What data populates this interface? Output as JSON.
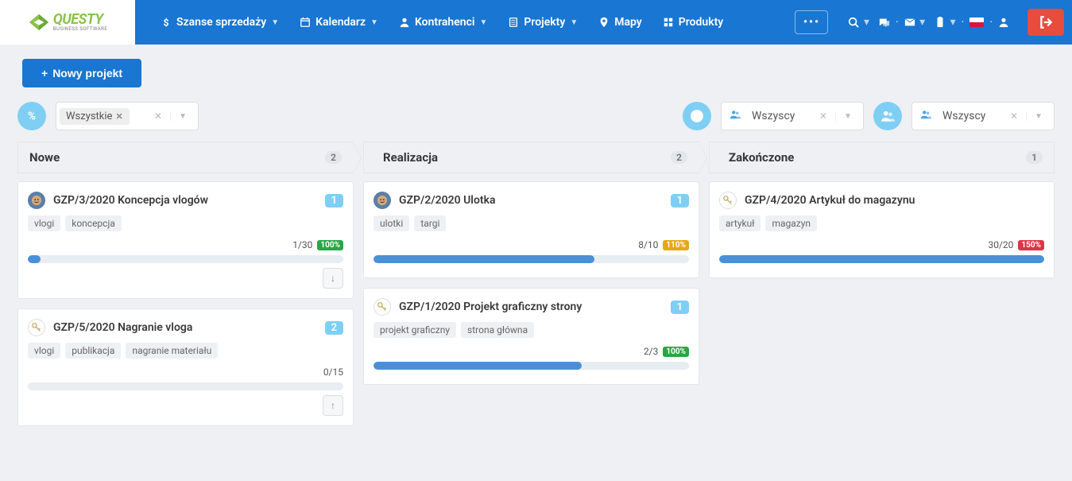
{
  "logo": {
    "brand": "QUESTY",
    "sub": "BUSINESS SOFTWARE"
  },
  "nav": {
    "items": [
      {
        "label": "Szanse sprzedaży",
        "icon": "dollar",
        "caret": true
      },
      {
        "label": "Kalendarz",
        "icon": "calendar",
        "caret": true
      },
      {
        "label": "Kontrahenci",
        "icon": "user",
        "caret": true
      },
      {
        "label": "Projekty",
        "icon": "clipboard",
        "caret": true
      },
      {
        "label": "Mapy",
        "icon": "pin",
        "caret": false
      },
      {
        "label": "Produkty",
        "icon": "grid",
        "caret": false
      }
    ]
  },
  "toolbar": {
    "new_project_label": "Nowy projekt"
  },
  "filters": {
    "tag": {
      "label": "Wszystkie"
    },
    "user1": {
      "label": "Wszyscy"
    },
    "user2": {
      "label": "Wszyscy"
    }
  },
  "columns": [
    {
      "title": "Nowe",
      "count": "2",
      "cards": [
        {
          "avatar": "a1",
          "title": "GZP/3/2020 Koncepcja vlogów",
          "badge": "1",
          "tags": [
            "vlogi",
            "koncepcja"
          ],
          "meta": "1/30",
          "pct": "100%",
          "pct_class": "pct-green",
          "progress": 4,
          "arrow": "down"
        },
        {
          "avatar": "a2",
          "title": "GZP/5/2020 Nagranie vloga",
          "badge": "2",
          "tags": [
            "vlogi",
            "publikacja",
            "nagranie materiału"
          ],
          "meta": "0/15",
          "pct": "",
          "pct_class": "",
          "progress": 0,
          "arrow": "up"
        }
      ]
    },
    {
      "title": "Realizacja",
      "count": "2",
      "cards": [
        {
          "avatar": "a1",
          "title": "GZP/2/2020 Ulotka",
          "badge": "1",
          "tags": [
            "ulotki",
            "targi"
          ],
          "meta": "8/10",
          "pct": "110%",
          "pct_class": "pct-orange",
          "progress": 70,
          "arrow": ""
        },
        {
          "avatar": "a2",
          "title": "GZP/1/2020 Projekt graficzny strony",
          "badge": "1",
          "tags": [
            "projekt graficzny",
            "strona główna"
          ],
          "meta": "2/3",
          "pct": "100%",
          "pct_class": "pct-green",
          "progress": 66,
          "arrow": ""
        }
      ]
    },
    {
      "title": "Zakończone",
      "count": "1",
      "cards": [
        {
          "avatar": "a2",
          "title": "GZP/4/2020 Artykuł do magazynu",
          "badge": "",
          "tags": [
            "artykuł",
            "magazyn"
          ],
          "meta": "30/20",
          "pct": "150%",
          "pct_class": "pct-red",
          "progress": 100,
          "arrow": ""
        }
      ]
    }
  ]
}
